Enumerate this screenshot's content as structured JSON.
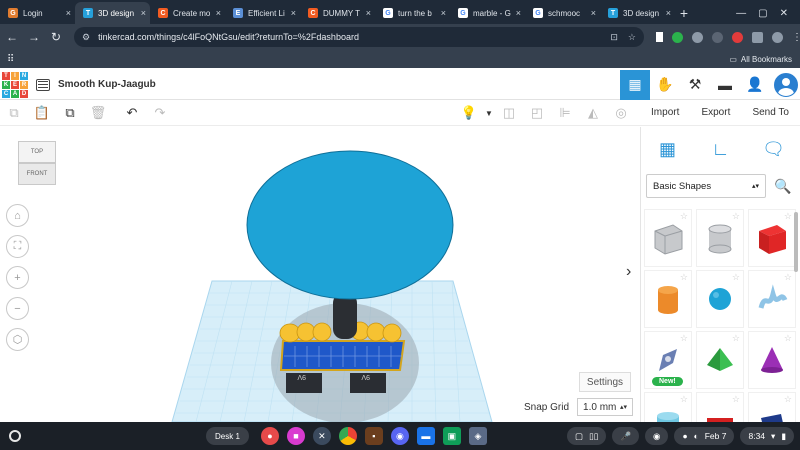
{
  "browser": {
    "tabs": [
      {
        "title": "Login",
        "favicon_color": "#e07c30",
        "favicon": "G",
        "active": false
      },
      {
        "title": "3D design",
        "favicon_color": "#26a0da",
        "favicon": "T",
        "active": true
      },
      {
        "title": "Create mo",
        "favicon_color": "#f25c22",
        "favicon": "C",
        "active": false
      },
      {
        "title": "Efficient Li",
        "favicon_color": "#5b8fd6",
        "favicon": "E",
        "active": false
      },
      {
        "title": "DUMMY T",
        "favicon_color": "#f25c22",
        "favicon": "C",
        "active": false
      },
      {
        "title": "turn the b",
        "favicon_color": "#ffffff",
        "favicon": "G",
        "active": false
      },
      {
        "title": "marble - G",
        "favicon_color": "#ffffff",
        "favicon": "G",
        "active": false
      },
      {
        "title": "schmooc",
        "favicon_color": "#ffffff",
        "favicon": "G",
        "active": false
      },
      {
        "title": "3D design",
        "favicon_color": "#26a0da",
        "favicon": "T",
        "active": false
      }
    ],
    "url": "tinkercad.com/things/c4lFoQNtGsu/edit?returnTo=%2Fdashboard",
    "all_bookmarks": "All Bookmarks"
  },
  "app": {
    "logo_letters": [
      "T",
      "I",
      "N",
      "K",
      "E",
      "R",
      "C",
      "A",
      "D"
    ],
    "logo_colors": [
      "#e8473a",
      "#f7a33a",
      "#29a9e0",
      "#2bb24c",
      "#e8473a",
      "#f7a33a",
      "#29a9e0",
      "#2bb24c",
      "#e8473a"
    ],
    "design_title": "Smooth Kup-Jaagub",
    "import_label": "Import",
    "export_label": "Export",
    "send_to_label": "Send To"
  },
  "viewcube": {
    "top": "TOP",
    "front": "FRONT"
  },
  "viewport": {
    "settings_label": "Settings",
    "snap_grid_label": "Snap Grid",
    "snap_grid_value": "1.0 mm",
    "block_label_left": "9V",
    "block_label_right": "9V"
  },
  "panel": {
    "shape_category": "Basic Shapes",
    "new_badge": "New!",
    "shapes": [
      "box-hole",
      "cylinder-hole",
      "box",
      "cylinder",
      "sphere",
      "scribble",
      "shape-generator",
      "pyramid",
      "cone",
      "roof",
      "text",
      "wedge"
    ]
  },
  "shelf": {
    "desk_label": "Desk 1",
    "date": "Feb 7",
    "time": "8:34"
  },
  "colors": {
    "accent": "#2a94d6",
    "balloon": "#1ea3d6",
    "grid": "#cde9f6"
  }
}
